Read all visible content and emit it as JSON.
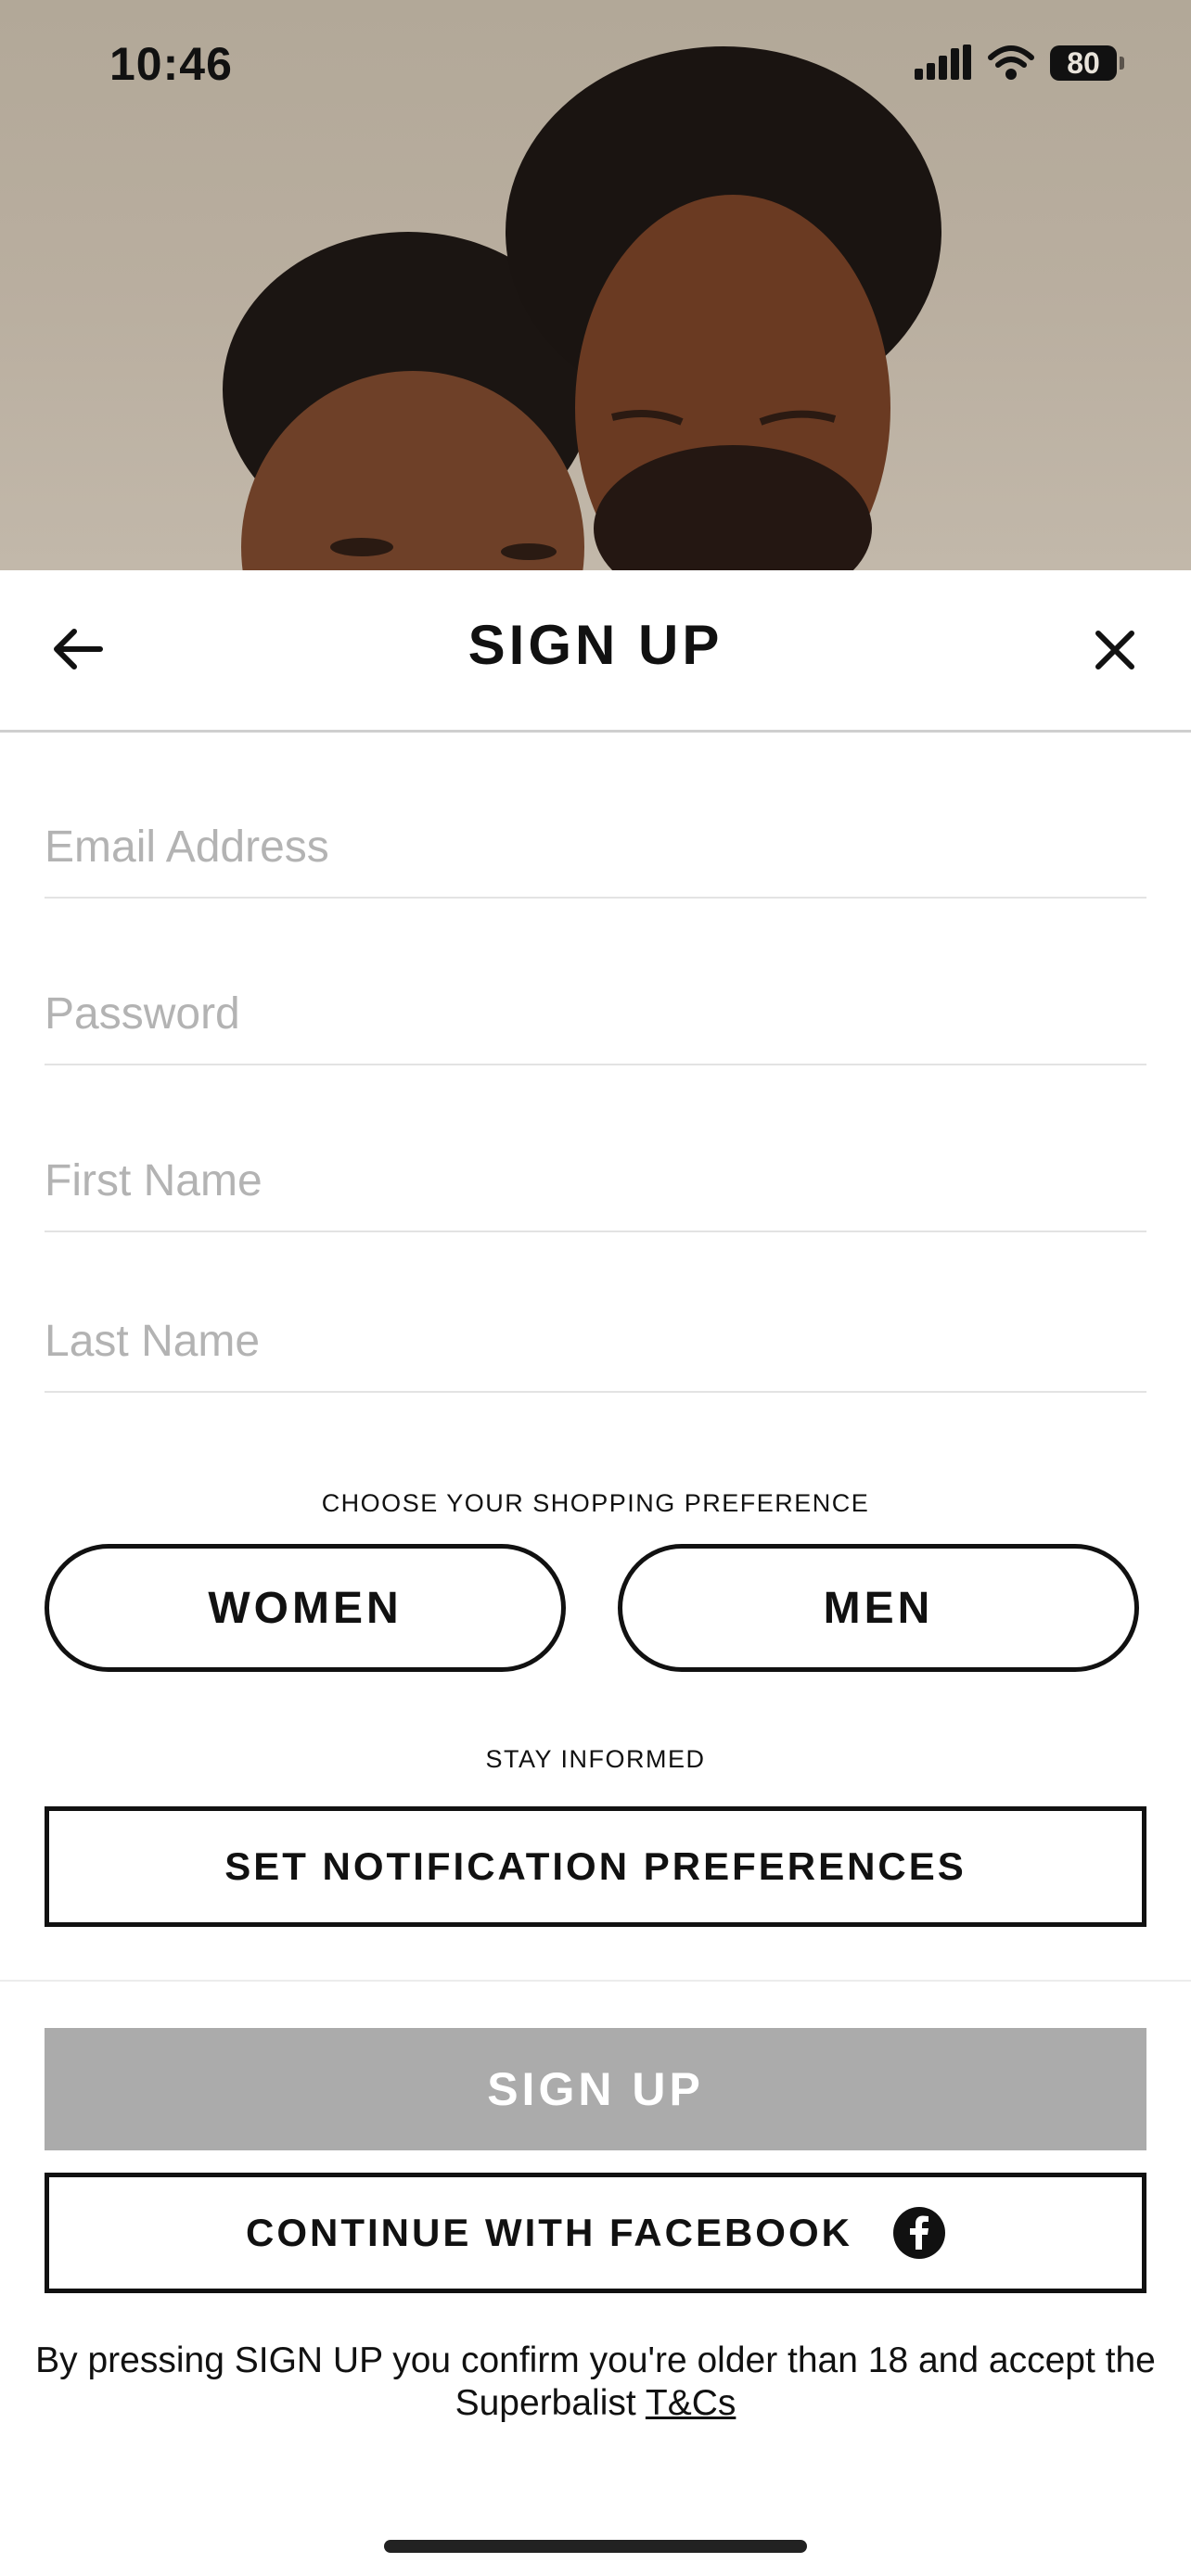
{
  "status_bar": {
    "time": "10:46",
    "battery": "80"
  },
  "header": {
    "title": "SIGN UP"
  },
  "form": {
    "email_placeholder": "Email Address",
    "password_placeholder": "Password",
    "first_name_placeholder": "First Name",
    "last_name_placeholder": "Last Name"
  },
  "preference": {
    "caption": "CHOOSE YOUR SHOPPING PREFERENCE",
    "women_label": "WOMEN",
    "men_label": "MEN"
  },
  "notifications": {
    "caption": "STAY INFORMED",
    "button_label": "SET NOTIFICATION PREFERENCES"
  },
  "actions": {
    "signup_label": "SIGN UP",
    "facebook_label": "CONTINUE WITH FACEBOOK"
  },
  "legal": {
    "text": "By pressing SIGN UP you confirm you're older than 18 and accept the Superbalist",
    "link": "T&Cs"
  },
  "colors": {
    "disabled_button": "#ababab",
    "hero_background": "#b9ae9f"
  }
}
